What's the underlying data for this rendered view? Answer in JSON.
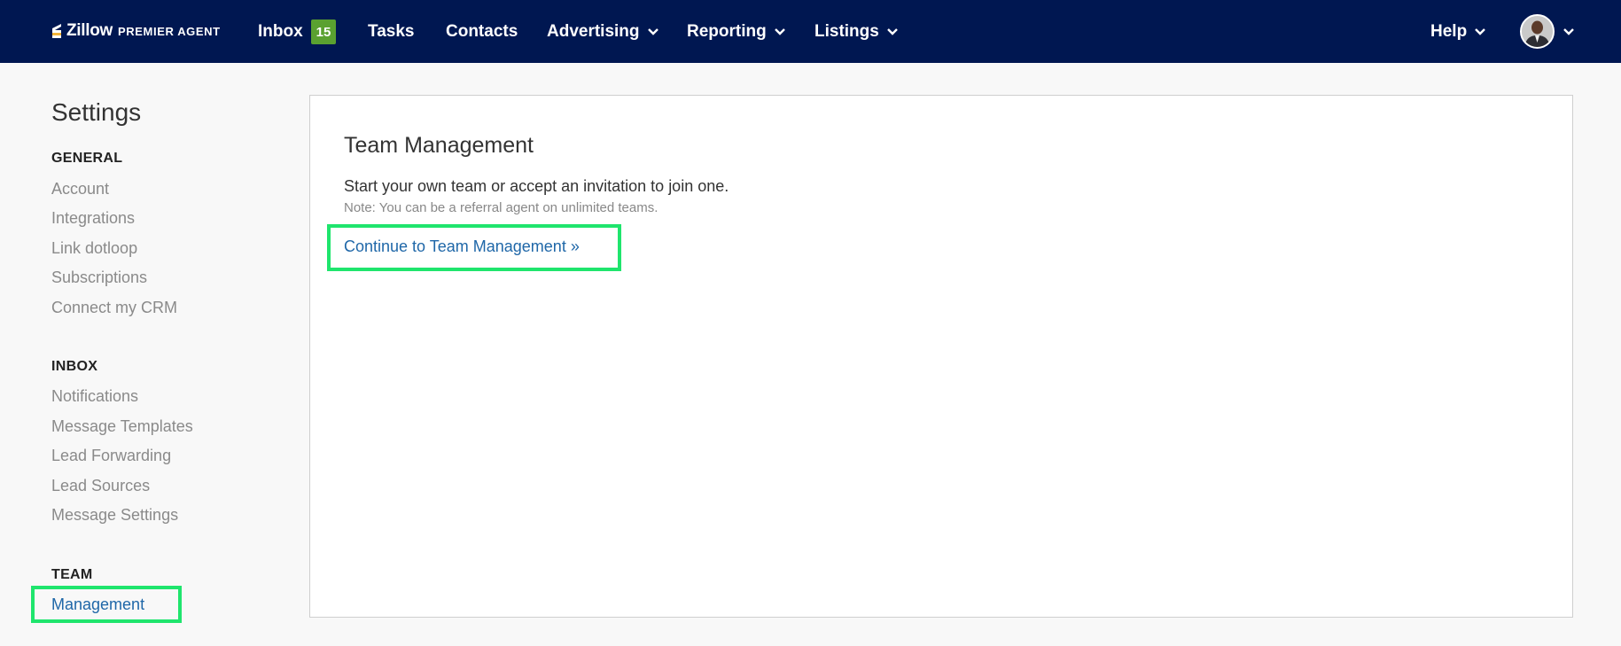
{
  "colors": {
    "nav_bg": "#001751",
    "badge_bg": "#5aa130",
    "link": "#1f67a8",
    "highlight": "#1fe56d"
  },
  "header": {
    "logo_word": "Zillow",
    "logo_sub": "PREMIER AGENT",
    "nav": {
      "inbox": "Inbox",
      "inbox_count": "15",
      "tasks": "Tasks",
      "contacts": "Contacts",
      "advertising": "Advertising",
      "reporting": "Reporting",
      "listings": "Listings",
      "help": "Help"
    },
    "icons": {
      "logo": "zillow-logo-icon",
      "dropdown": "chevron-down-icon",
      "avatar": "user-avatar"
    }
  },
  "sidebar": {
    "title": "Settings",
    "general": {
      "heading": "GENERAL",
      "items": [
        "Account",
        "Integrations",
        "Link dotloop",
        "Subscriptions",
        "Connect my CRM"
      ]
    },
    "inbox": {
      "heading": "INBOX",
      "items": [
        "Notifications",
        "Message Templates",
        "Lead Forwarding",
        "Lead Sources",
        "Message Settings"
      ]
    },
    "team": {
      "heading": "TEAM",
      "items": [
        "Management"
      ]
    }
  },
  "main": {
    "title": "Team Management",
    "description": "Start your own team or accept an invitation to join one.",
    "note": "Note: You can be a referral agent on unlimited teams.",
    "link": "Continue to Team Management »"
  }
}
